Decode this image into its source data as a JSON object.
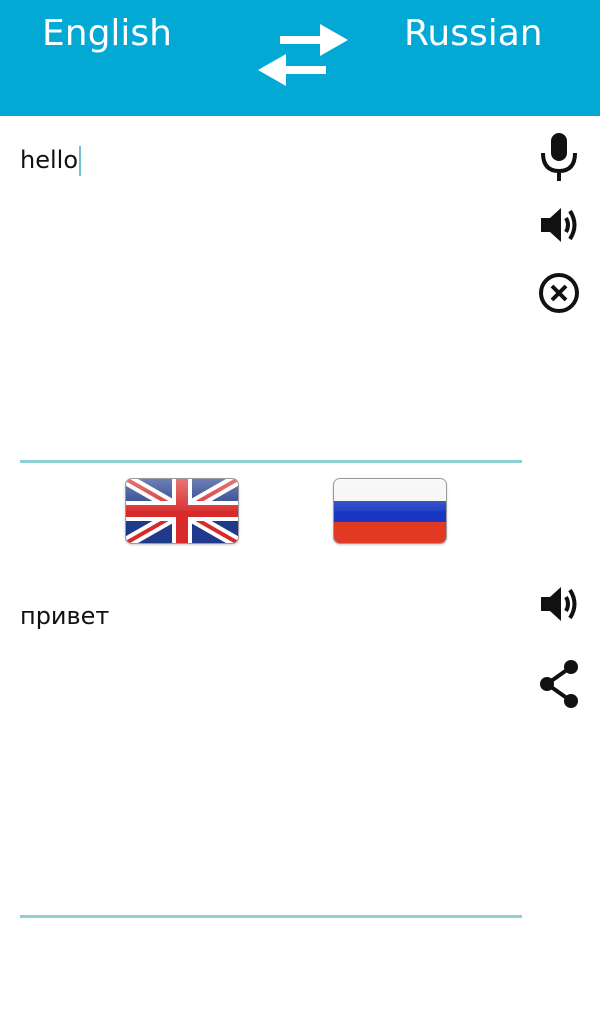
{
  "header": {
    "source_language": "English",
    "target_language": "Russian",
    "background_color": "#03a9d5",
    "swap_icon": "swap-arrows-icon"
  },
  "input": {
    "text": "hello",
    "icons": [
      "microphone-icon",
      "speaker-icon",
      "clear-icon"
    ]
  },
  "flags": {
    "source": "uk-flag-icon",
    "target": "russia-flag-icon"
  },
  "output": {
    "text": "привет",
    "icons": [
      "speaker-icon",
      "share-icon"
    ]
  },
  "colors": {
    "divider": "#8ecfd6",
    "caret": "#6fc3cc",
    "icon": "#111111"
  }
}
